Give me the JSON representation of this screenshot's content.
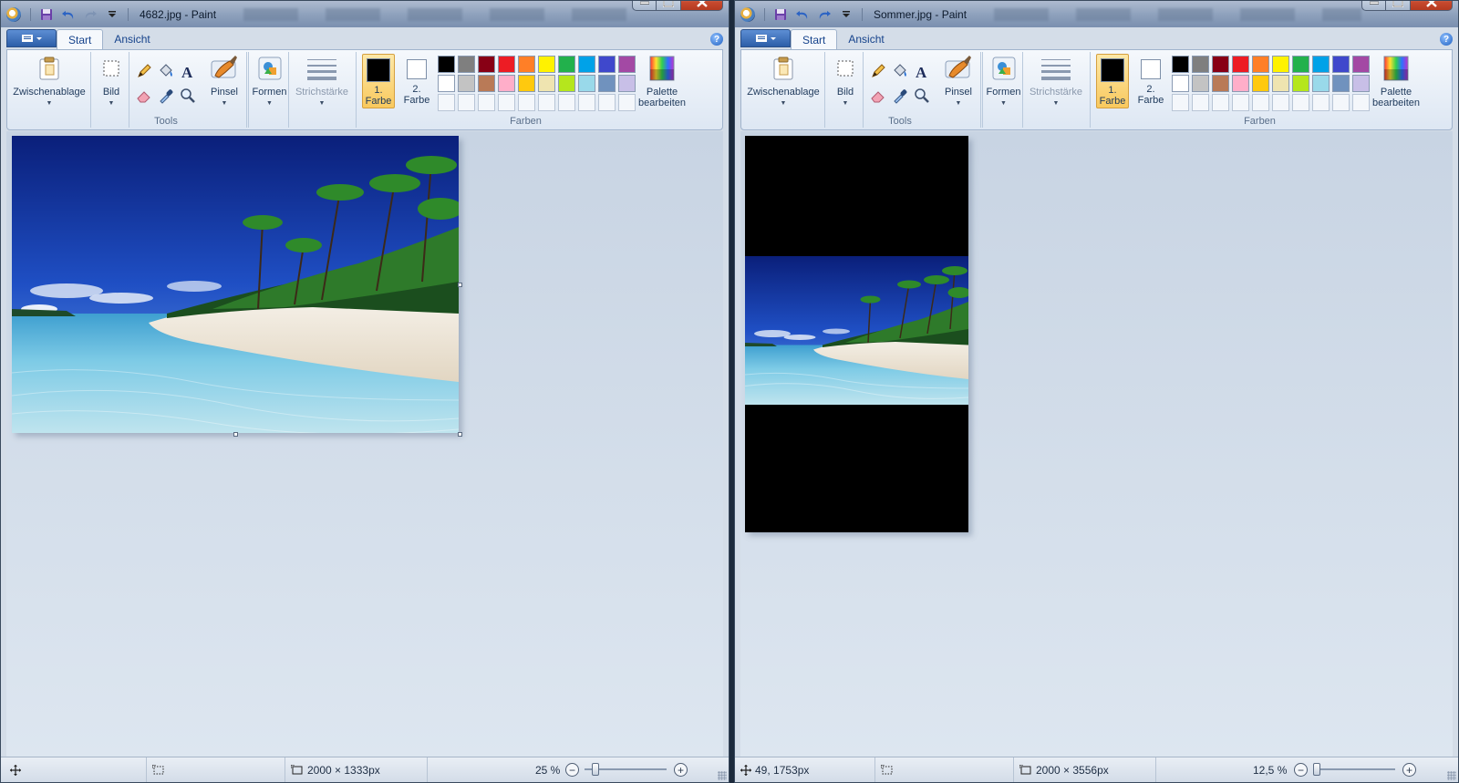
{
  "left": {
    "title": "4682.jpg - Paint",
    "tabs": [
      "Start",
      "Ansicht"
    ],
    "status": {
      "cursor_pos": "",
      "image_size": "2000 × 1333px",
      "zoom": "25 %"
    }
  },
  "right": {
    "title": "Sommer.jpg - Paint",
    "tabs": [
      "Start",
      "Ansicht"
    ],
    "status": {
      "cursor_pos": "49, 1753px",
      "image_size": "2000 × 3556px",
      "zoom": "12,5 %"
    }
  },
  "ribbon": {
    "clipboard": "Zwischenablage",
    "image": "Bild",
    "tools_group": "Tools",
    "brushes": "Pinsel",
    "shapes": "Formen",
    "stroke": "Strichstärke",
    "color1_a": "1.",
    "color1_b": "Farbe",
    "color2_a": "2.",
    "color2_b": "Farbe",
    "edit_palette_a": "Palette",
    "edit_palette_b": "bearbeiten",
    "colors_group": "Farben",
    "help": "?"
  },
  "colors": {
    "color1": "#000000",
    "color2": "#ffffff",
    "palette_row1": [
      "#000000",
      "#7f7f7f",
      "#880015",
      "#ed1c24",
      "#ff7f27",
      "#fff200",
      "#22b14c",
      "#00a2e8",
      "#3f48cc",
      "#a349a4"
    ],
    "palette_row2": [
      "#ffffff",
      "#c3c3c3",
      "#b97a57",
      "#ffaec9",
      "#ffc90e",
      "#efe4b0",
      "#b5e61d",
      "#99d9ea",
      "#7092be",
      "#c8bfe7"
    ]
  },
  "icons": [
    "paint-app-icon",
    "save-icon",
    "undo-icon",
    "redo-icon",
    "customize-qat-icon",
    "minimize-icon",
    "maximize-icon",
    "close-icon",
    "paste-icon",
    "select-icon",
    "pencil-icon",
    "fill-icon",
    "text-icon",
    "eraser-icon",
    "color-picker-icon",
    "magnifier-icon",
    "brush-icon",
    "shapes-icon",
    "stroke-icon",
    "edit-colors-icon",
    "move-cursor-icon",
    "selection-size-icon",
    "image-size-icon"
  ]
}
